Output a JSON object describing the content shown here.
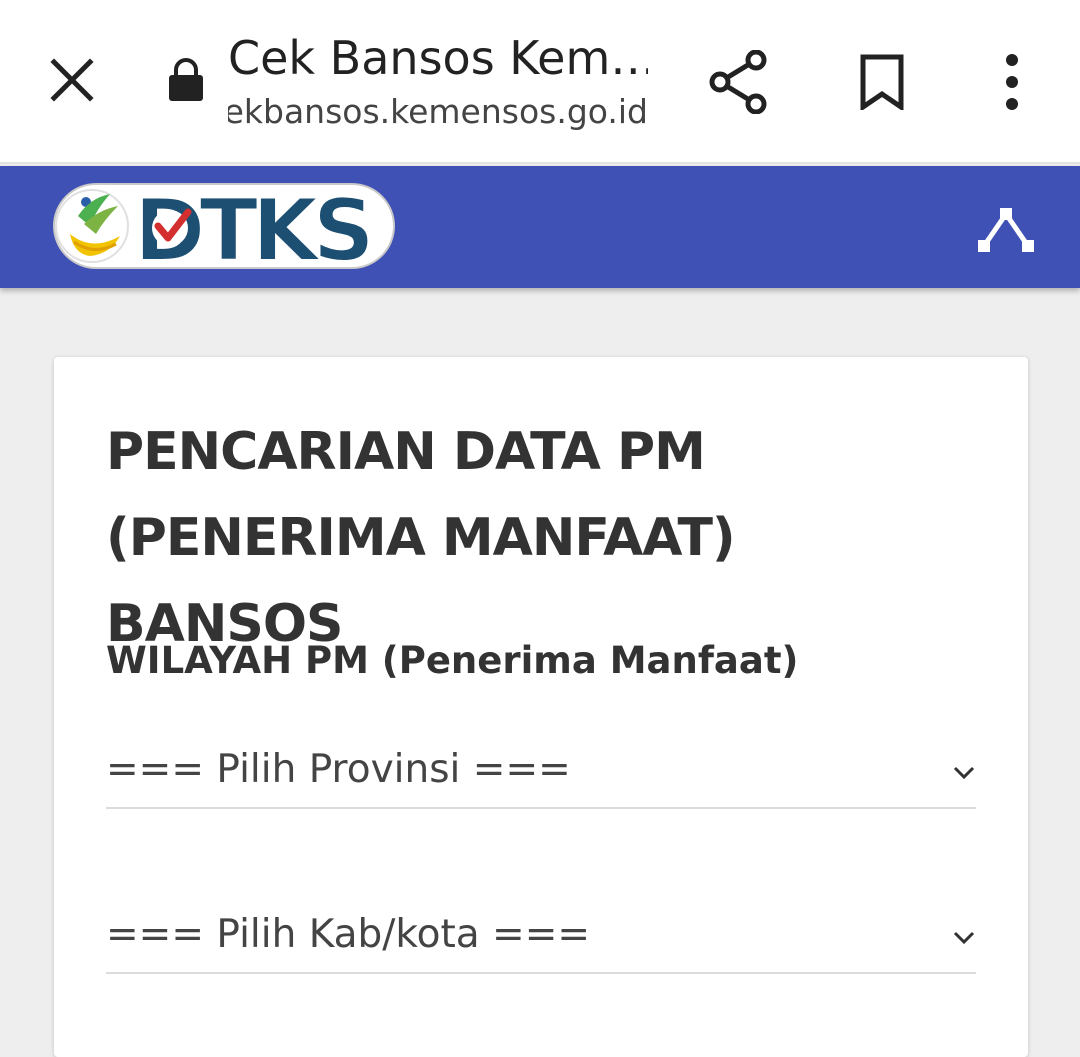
{
  "browser": {
    "page_title": "Cek Bansos Kem…",
    "url": "cekbansos.kemensos.go.id",
    "icons": [
      "close-icon",
      "lock-icon",
      "share-icon",
      "bookmark-icon",
      "more-vert-icon"
    ]
  },
  "header": {
    "logo_text": "DTKS",
    "background_color": "#3f51b5",
    "nav_icon": "nav-toggle-icon"
  },
  "form": {
    "title": "PENCARIAN DATA PM (PENERIMA MANFAAT) BANSOS",
    "section_label": "WILAYAH PM (Penerima Manfaat)",
    "province_select": {
      "value": "=== Pilih Provinsi ==="
    },
    "city_select": {
      "value": "=== Pilih Kab/kota ==="
    }
  }
}
